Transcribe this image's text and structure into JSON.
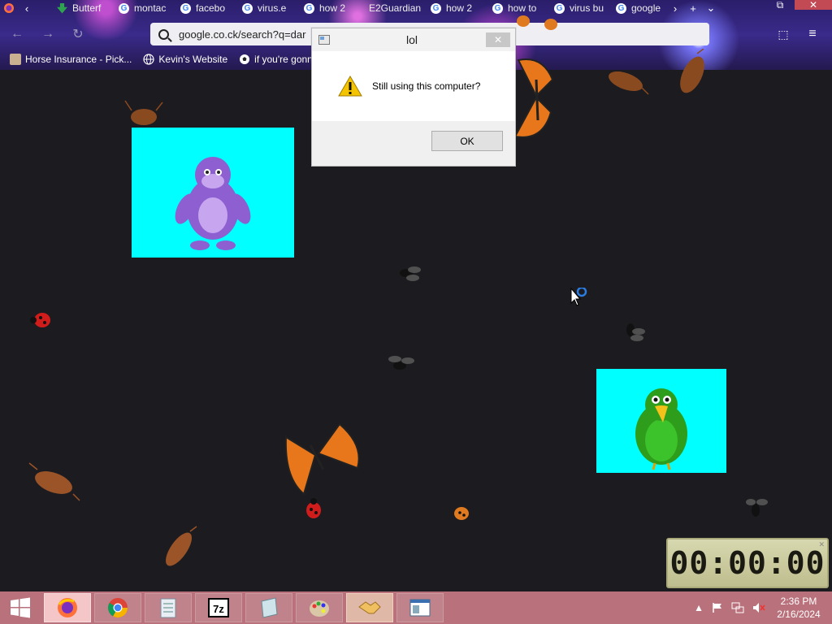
{
  "browser": {
    "tabs": [
      {
        "label": "Butterf",
        "icon": "download-icon"
      },
      {
        "label": "montac",
        "icon": "google-icon"
      },
      {
        "label": "facebo",
        "icon": "google-icon"
      },
      {
        "label": "virus.e",
        "icon": "google-icon"
      },
      {
        "label": "how 2",
        "icon": "google-icon"
      },
      {
        "label": "E2Guardian",
        "icon": "none"
      },
      {
        "label": "how 2",
        "icon": "google-icon"
      },
      {
        "label": "how to",
        "icon": "google-icon"
      },
      {
        "label": "virus bu",
        "icon": "google-icon"
      },
      {
        "label": "google",
        "icon": "google-icon"
      }
    ],
    "url": "google.co.ck/search?q=dar",
    "bookmarks": [
      {
        "label": "Horse Insurance - Pick...",
        "icon": "horse-icon"
      },
      {
        "label": "Kevin's Website",
        "icon": "globe-icon"
      },
      {
        "label": "if you're gonna",
        "icon": "soccer-ball-icon"
      }
    ]
  },
  "dialog": {
    "title": "lol",
    "message": "Still using this computer?",
    "ok_label": "OK",
    "close_glyph": "✕"
  },
  "timer": {
    "display": "00:00:00"
  },
  "taskbar": {
    "apps": [
      "firefox",
      "chrome",
      "notepad-plus",
      "7-zip",
      "paper",
      "paint",
      "handshake",
      "window-app"
    ],
    "time": "2:36 PM",
    "date": "2/16/2024"
  },
  "colors": {
    "desktop_bg": "#1c1b1f",
    "panel_cyan": "#00ffff",
    "taskbar": "#b9727c"
  }
}
